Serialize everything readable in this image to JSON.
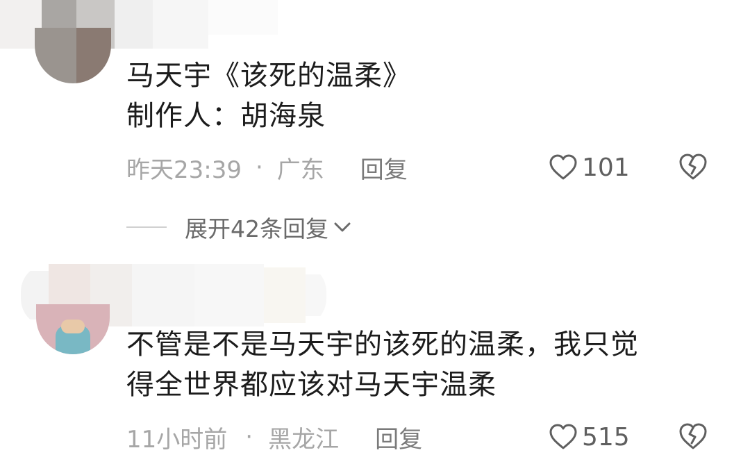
{
  "comments": [
    {
      "lines": [
        "马天宇《该死的温柔》",
        "制作人：胡海泉"
      ],
      "time": "昨天23:39",
      "dot": "·",
      "location": "广东",
      "reply_label": "回复",
      "likes": "101",
      "replies_toggle": "展开42条回复"
    },
    {
      "lines": [
        "不管是不是马天宇的该死的温柔，我只觉",
        "得全世界都应该对马天宇温柔"
      ],
      "time": "11小时前",
      "dot": "·",
      "location": "黑龙江",
      "reply_label": "回复",
      "likes": "515"
    }
  ],
  "icons": {
    "like": "heart-outline-icon",
    "dislike": "broken-heart-icon",
    "expand": "chevron-down-icon"
  },
  "colors": {
    "text": "#1c1c1c",
    "meta": "#a6a6a6",
    "icon": "#5f5f5f"
  }
}
